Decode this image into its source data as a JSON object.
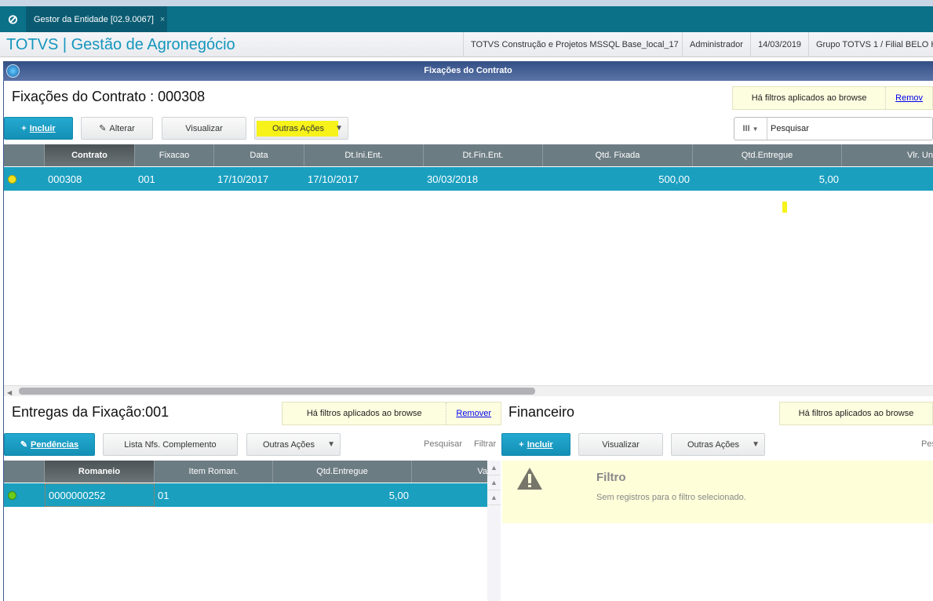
{
  "tabbar": {
    "tab_label": "Gestor da Entidade [02.9.0067]",
    "close": "×"
  },
  "header": {
    "title": "TOTVS | Gestão de Agronegócio",
    "info": [
      "TOTVS Construção e Projetos MSSQL Base_local_17",
      "Administrador",
      "14/03/2019",
      "Grupo TOTVS 1 / Filial BELO HO"
    ]
  },
  "window": {
    "title": "Fixações do Contrato"
  },
  "main": {
    "title": "Fixações do Contrato : 000308",
    "filter_text": "Há filtros aplicados ao browse",
    "filter_remove": "Remov",
    "buttons": {
      "incluir": "Incluir",
      "alterar": "Alterar",
      "visualizar": "Visualizar",
      "outras": "Outras Ações"
    },
    "search_placeholder": "Pesquisar",
    "columns": [
      "Contrato",
      "Fixacao",
      "Data",
      "Dt.Ini.Ent.",
      "Dt.Fin.Ent.",
      "Qtd. Fixada",
      "Qtd.Entregue",
      "Vlr. Un"
    ],
    "rows": [
      {
        "status_color": "#f0e020",
        "cells": [
          "000308",
          "001",
          "17/10/2017",
          "17/10/2017",
          "30/03/2018",
          "500,00",
          "5,00",
          ""
        ]
      }
    ]
  },
  "entregas": {
    "title": "Entregas da Fixação:001",
    "filter_text": "Há filtros aplicados ao browse",
    "filter_remove": "Remover",
    "buttons": {
      "pendencias": "Pendências",
      "lista": "Lista Nfs. Complemento",
      "outras": "Outras Ações"
    },
    "pesquisar": "Pesquisar",
    "filtrar": "Filtrar",
    "columns": [
      "Romaneio",
      "Item Roman.",
      "Qtd.Entregue",
      "Va"
    ],
    "rows": [
      {
        "status_color": "#6ccc1e",
        "cells": [
          "0000000252",
          "01",
          "5,00",
          ""
        ]
      }
    ]
  },
  "financeiro": {
    "title": "Financeiro",
    "filter_text": "Há filtros aplicados ao browse",
    "buttons": {
      "incluir": "Incluir",
      "visualizar": "Visualizar",
      "outras": "Outras Ações"
    },
    "pesquisar": "Pes",
    "empty_title": "Filtro",
    "empty_text": "Sem registros para o filtro selecionado."
  }
}
